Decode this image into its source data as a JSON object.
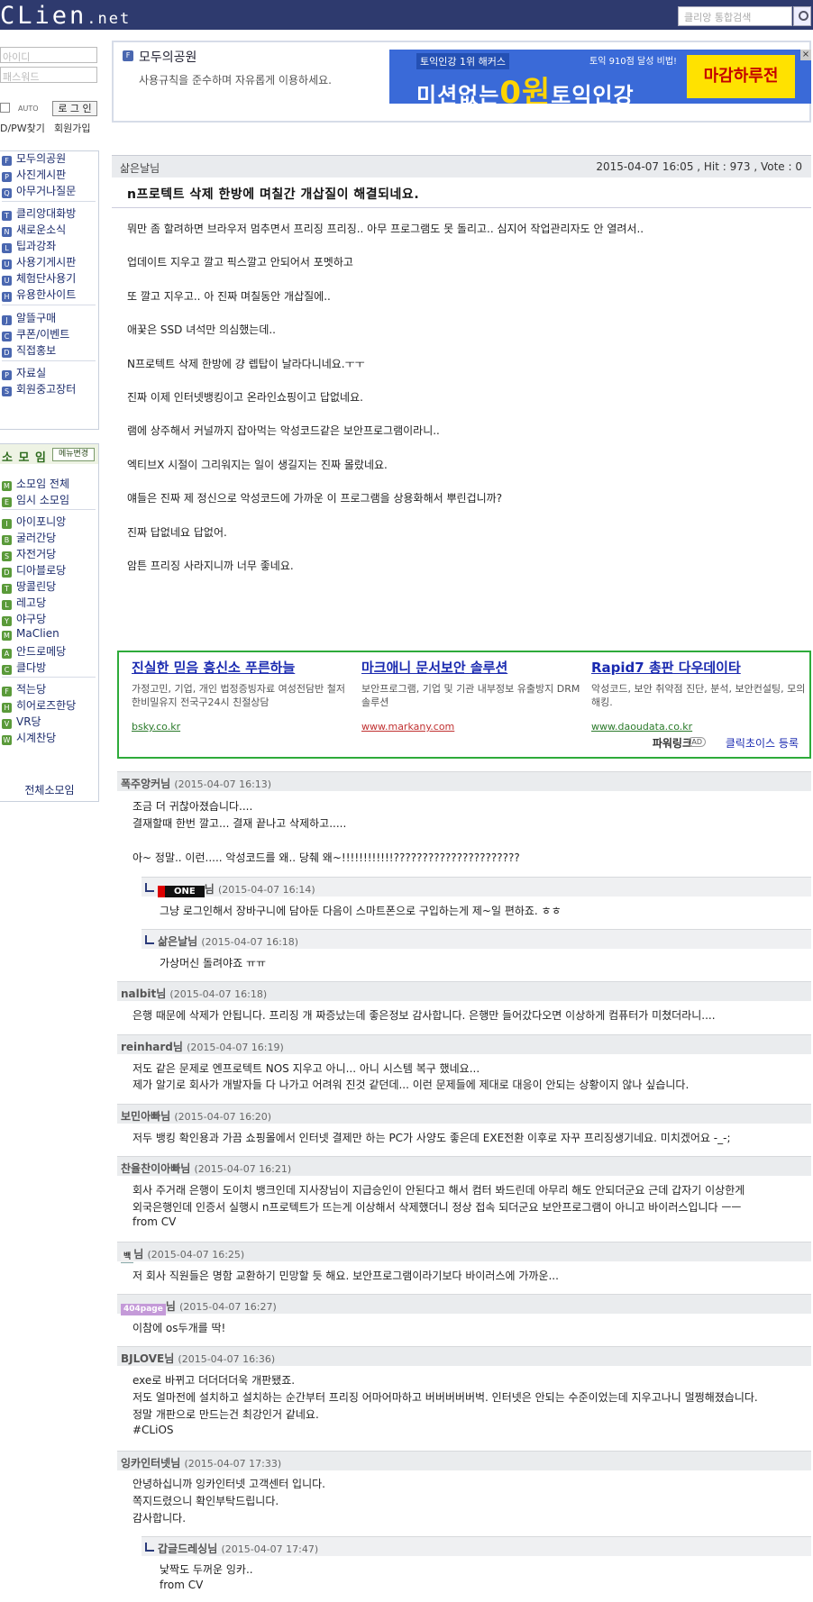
{
  "site": {
    "logo": "CLien",
    "logo_suffix": ".net"
  },
  "search": {
    "placeholder": "클리앙 통합검색"
  },
  "login": {
    "id_placeholder": "아이디",
    "pw_placeholder": "패스워드",
    "auto_label": "AUTO",
    "login_button": "로 그 인",
    "find_label": "D/PW찾기",
    "join_label": "회원가입"
  },
  "sidebar": {
    "menu": [
      {
        "icon": "F",
        "label": "모두의공원"
      },
      {
        "icon": "P",
        "label": "사진게시판"
      },
      {
        "icon": "Q",
        "label": "아무거나질문"
      },
      {
        "icon": "T",
        "label": "클리앙대화방"
      },
      {
        "icon": "N",
        "label": "새로운소식"
      },
      {
        "icon": "L",
        "label": "팁과강좌"
      },
      {
        "icon": "U",
        "label": "사용기게시판"
      },
      {
        "icon": "U",
        "label": "체험단사용기"
      },
      {
        "icon": "H",
        "label": "유용한사이트"
      },
      {
        "icon": "J",
        "label": "알뜰구매"
      },
      {
        "icon": "C",
        "label": "쿠폰/이벤트"
      },
      {
        "icon": "D",
        "label": "직접홍보"
      },
      {
        "icon": "P",
        "label": "자료실"
      },
      {
        "icon": "S",
        "label": "회원중고장터"
      }
    ],
    "somoim_title": "소 모 임",
    "somoim_edit": "메뉴변경",
    "somoim": [
      {
        "icon": "M",
        "label": "소모임 전체"
      },
      {
        "icon": "E",
        "label": "임시 소모임"
      },
      {
        "icon": "I",
        "label": "아이포니앙"
      },
      {
        "icon": "B",
        "label": "굴러간당"
      },
      {
        "icon": "S",
        "label": "자전거당"
      },
      {
        "icon": "D",
        "label": "디아블로당"
      },
      {
        "icon": "T",
        "label": "땅콜린당"
      },
      {
        "icon": "L",
        "label": "레고당"
      },
      {
        "icon": "Y",
        "label": "야구당"
      },
      {
        "icon": "M",
        "label": "MaClien"
      },
      {
        "icon": "A",
        "label": "안드로메당"
      },
      {
        "icon": "C",
        "label": "클다방"
      },
      {
        "icon": "F",
        "label": "적는당"
      },
      {
        "icon": "H",
        "label": "히어로즈한당"
      },
      {
        "icon": "V",
        "label": "VR당"
      },
      {
        "icon": "W",
        "label": "시계찬당"
      }
    ],
    "somoim_all": "전체소모임"
  },
  "board": {
    "title": "모두의공원",
    "description": "사용규칙을 준수하며 자유롭게 이용하세요."
  },
  "banner": {
    "top_text": "토익인강 1위 해커스",
    "main_prefix": "미션없는",
    "main_zero": "0원",
    "main_suffix": "토익인강",
    "small": "토익 910점 달성 비법!",
    "cta": "마감하루전"
  },
  "post": {
    "author": "삶은날님",
    "meta": "2015-04-07 16:05 , Hit : 973 , Vote : 0",
    "title": "n프로텍트 삭제 한방에 며칠간 개삽질이 해결되네요.",
    "lines": [
      "뭐만 좀 할려하면 브라우저 멈추면서 프리징 프리징.. 아무 프로그램도 못 돌리고.. 심지어 작업관리자도 안 열려서..",
      "업데이트 지우고 깔고 픽스깔고 안되어서 포멧하고",
      "또 깔고 지우고.. 아 진짜 며칠동안 개삽질에..",
      "애꿎은 SSD 녀석만 의심했는데..",
      "N프로텍트 삭제 한방에 걍 렙탑이 날라다니네요.ㅜㅜ",
      "진짜 이제 인터넷뱅킹이고 온라인쇼핑이고 답없네요.",
      "램에 상주해서 커널까지 잡아먹는 악성코드같은 보안프로그램이라니..",
      "엑티브X 시절이 그리워지는 일이 생길지는 진짜 몰랐네요.",
      "얘들은 진짜 제 정신으로 악성코드에 가까운 이 프로그램을 상용화해서 뿌린겁니까?",
      "진짜 답없네요 답없어.",
      "암튼 프리징 사라지니까 너무 좋네요."
    ]
  },
  "ads": {
    "items": [
      {
        "title": "진실한 믿음 흥신소 푸른하늘",
        "desc": "가정고민, 기업, 개인 법정증빙자료 여성전담반 철저한비밀유지 전국구24시 친절상담",
        "url": "bsky.co.kr"
      },
      {
        "title": "마크애니 문서보안 솔루션",
        "desc": "보안프로그램, 기업 및 기관 내부정보 유출방지 DRM 솔루션",
        "url": "www.markany.com"
      },
      {
        "title": "Rapid7 총판 다우데이타",
        "desc": "악성코드, 보안 취약점 진단, 분석, 보안컨설팅, 모의해킹.",
        "url": "www.daoudata.co.kr"
      }
    ],
    "powerlink": "파워링크",
    "ad_badge": "AD",
    "register": "클릭초이스 등록"
  },
  "comments": [
    {
      "author": "폭주앙커님",
      "date": "(2015-04-07 16:13)",
      "lines": [
        "조금 더 귀찮아졌습니다....",
        "결재할때 한번 깔고... 결재 끝나고 삭제하고.....",
        "",
        "아~ 정말.. 이런..... 악성코드를 왜.. 당췌 왜~!!!!!!!!!!!!??????????????????????"
      ]
    },
    {
      "author": "님",
      "nick_img": "ONE",
      "date": "(2015-04-07 16:14)",
      "lines": [
        "그냥 로그인해서 장바구니에 담아둔 다음이 스마트폰으로 구입하는게 제~일 편하죠. ㅎㅎ"
      ]
    },
    {
      "author": "삶은날님",
      "date": "(2015-04-07 16:18)",
      "lines": [
        "가상머신 돌려야죠 ㅠㅠ"
      ]
    },
    {
      "author": "nalbit님",
      "date": "(2015-04-07 16:18)",
      "lines": [
        "은행 때문에 삭제가 안됩니다. 프리징 개 짜증났는데 좋은정보 감사합니다. 은행만 들어갔다오면 이상하게 컴퓨터가 미쳤더라니...."
      ]
    },
    {
      "author": "reinhard님",
      "date": "(2015-04-07 16:19)",
      "lines": [
        "저도 같은 문제로 엔프로텍트 NOS 지우고 아니... 아니 시스템 복구 했네요...",
        "제가 알기로 회사가 개발자들 다 나가고 어려워 진것 같던데... 이런 문제들에 제대로 대응이 안되는 상황이지 않나 싶습니다."
      ]
    },
    {
      "author": "보민아빠님",
      "date": "(2015-04-07 16:20)",
      "lines": [
        "저두 뱅킹 확인용과 가끔 쇼핑몰에서 인터넷 결제만 하는 PC가 사양도 좋은데 EXE전환 이후로 자꾸 프리징생기네요. 미치겠어요 -_-;"
      ]
    },
    {
      "author": "찬율찬이아빠님",
      "date": "(2015-04-07 16:21)",
      "lines": [
        "회사 주거래  은행이 도이치 뱅크인데 지사장님이 지급승인이 안된다고 해서 컴터 봐드린데 아무리 해도 안되더군요  근데 갑자기 이상한게",
        "외국은행인데 인증서 실행시 n프로텍트가 뜨는게 이상해서 삭제했더니 정상 접속 되더군요 보안프로그램이 아니고 바이러스입니다 ㅡㅡ",
        "from CV"
      ]
    },
    {
      "author": "님",
      "nick_img": "백",
      "date": "(2015-04-07 16:25)",
      "lines": [
        "저 회사 직원들은 명함 교환하기 민망할 듯 해요. 보안프로그램이라기보다 바이러스에 가까운..."
      ]
    },
    {
      "author": "님",
      "nick_img": "404page",
      "date": "(2015-04-07 16:27)",
      "lines": [
        "이참에 os두개를 딱!"
      ]
    },
    {
      "author": "BJLOVE님",
      "date": "(2015-04-07 16:36)",
      "lines": [
        "exe로 바뀌고 더더더더욱 개판됐죠.",
        "저도 얼마전에 설치하고 설치하는 순간부터 프리징 어마어마하고 버버버버버벅. 인터넷은 안되는 수준이었는데 지우고나니 멀쩡해졌습니다.",
        "정말 개판으로 만드는건 최강인거 같네요.",
        "#CLiOS"
      ]
    },
    {
      "author": "잉카인터넷님",
      "date": "(2015-04-07 17:33)",
      "lines": [
        "안녕하십니까 잉카인터넷 고객센터 입니다.",
        "쪽지드렸으니 확인부탁드립니다.",
        "감사합니다."
      ]
    },
    {
      "author": "갑글드레싱님",
      "date": "(2015-04-07 17:47)",
      "lines": [
        "낯짝도 두꺼운 잉카..",
        "from CV"
      ]
    }
  ],
  "colors": {
    "topbar": "#2e3a6e",
    "accent_green": "#2eab3a",
    "link_blue": "#1a2ab0"
  }
}
